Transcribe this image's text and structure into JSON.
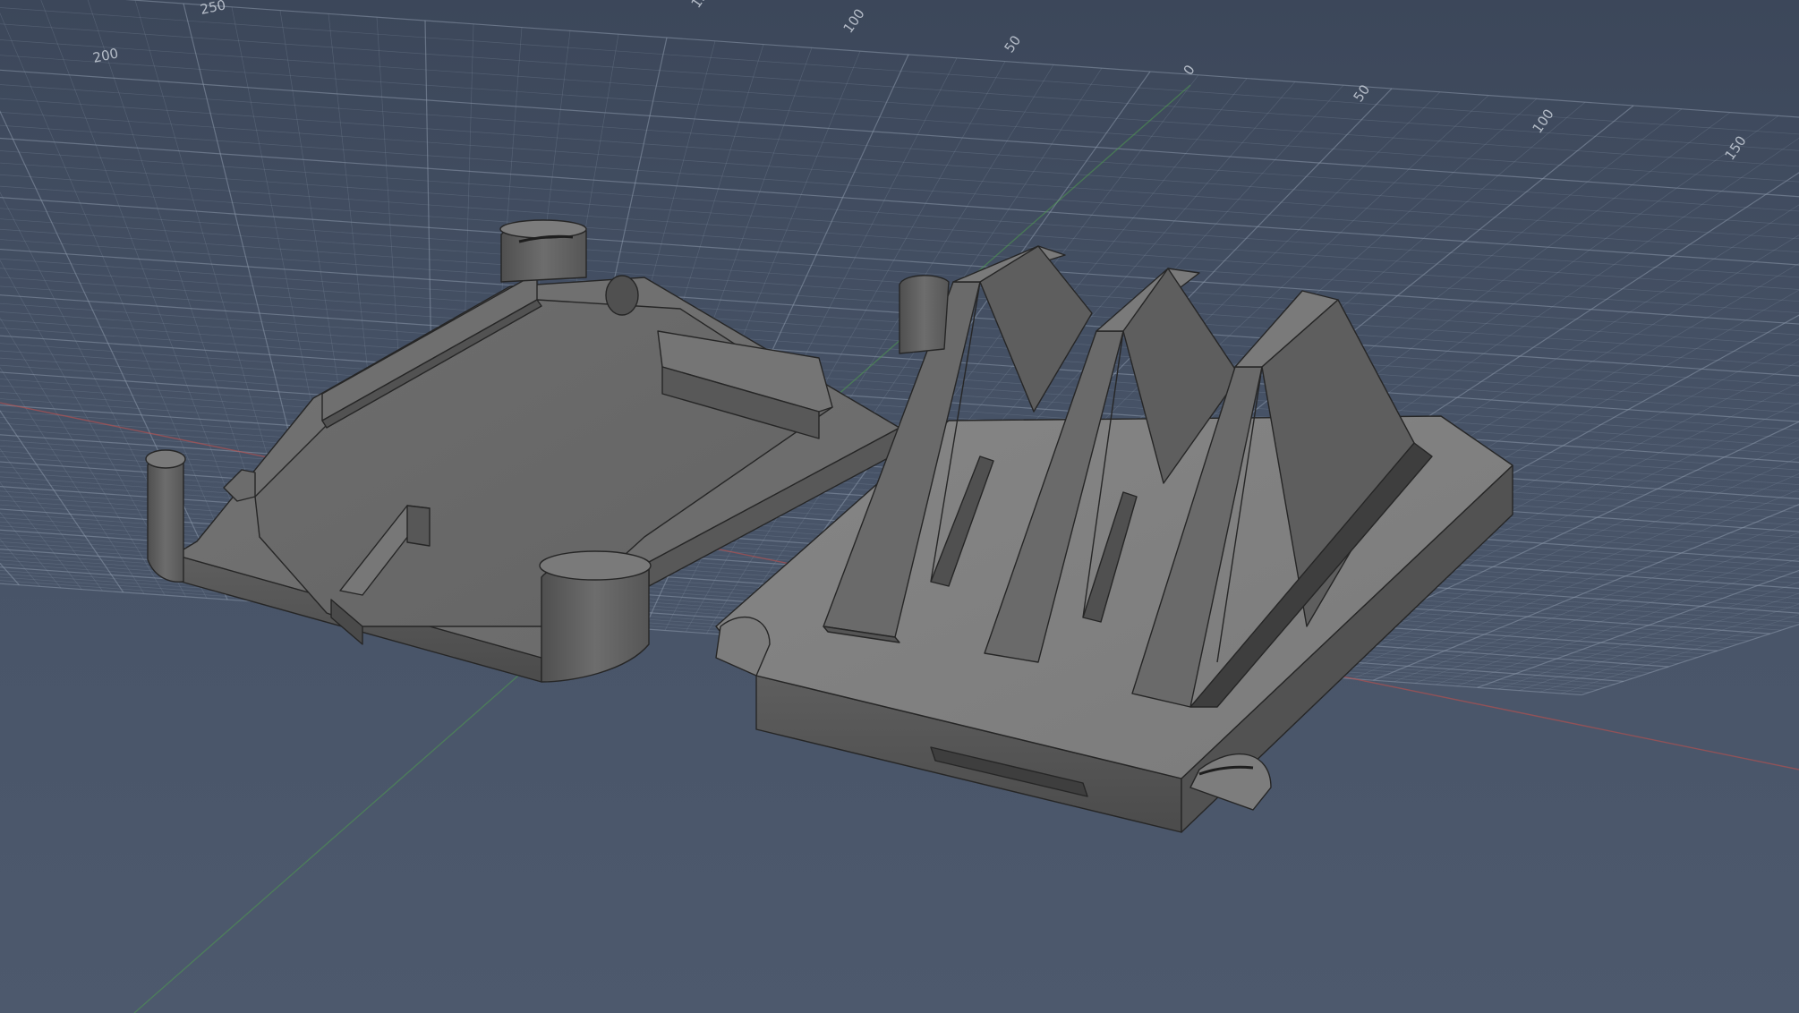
{
  "viewport": {
    "name": "3D CAD viewport",
    "background_color": "#44506a",
    "grid_color": "#8a97aa",
    "model_color": "#6b6b6b",
    "x_axis_color": "#c0504d",
    "y_axis_color": "#4f9a4f"
  },
  "grid": {
    "top_ticks": [
      "250",
      "200",
      "150",
      "100",
      "50",
      "0",
      "50",
      "100",
      "150"
    ],
    "left_ticks": [
      "250",
      "200"
    ]
  },
  "model": {
    "parts": [
      {
        "name": "left-tray-half"
      },
      {
        "name": "right-stand-half"
      }
    ],
    "stand_ribs": 3
  }
}
